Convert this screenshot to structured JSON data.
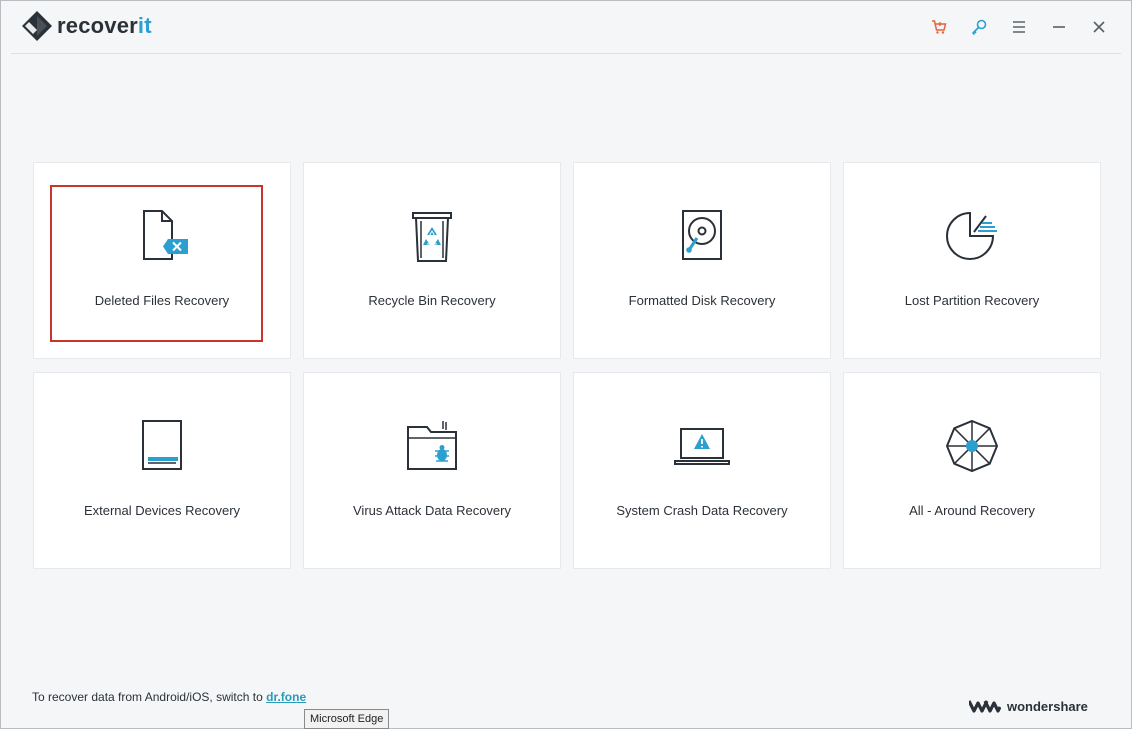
{
  "app": {
    "name_main": "recover",
    "name_accent": "it"
  },
  "toolbar": {
    "icons": [
      "cart-icon",
      "key-icon",
      "menu-icon",
      "minimize-icon",
      "close-icon"
    ],
    "accent_colors": {
      "cart": "#e5633a",
      "key": "#2b9fd0"
    }
  },
  "cards": [
    {
      "label": "Deleted Files Recovery",
      "icon": "deleted-file-icon",
      "selected": true
    },
    {
      "label": "Recycle Bin Recovery",
      "icon": "recycle-bin-icon"
    },
    {
      "label": "Formatted Disk Recovery",
      "icon": "hard-disk-icon"
    },
    {
      "label": "Lost Partition Recovery",
      "icon": "partition-icon"
    },
    {
      "label": "External Devices Recovery",
      "icon": "external-device-icon"
    },
    {
      "label": "Virus Attack Data Recovery",
      "icon": "virus-folder-icon"
    },
    {
      "label": "System Crash Data Recovery",
      "icon": "crashed-laptop-icon"
    },
    {
      "label": "All - Around Recovery",
      "icon": "all-around-icon"
    }
  ],
  "footer": {
    "note": "To recover data from Android/iOS, switch to ",
    "link": "dr.fone",
    "tooltip": "Microsoft Edge",
    "brand": "wondershare"
  },
  "colors": {
    "accent": "#2b9fd0",
    "selection": "#c7362c",
    "text": "#2b3138"
  }
}
